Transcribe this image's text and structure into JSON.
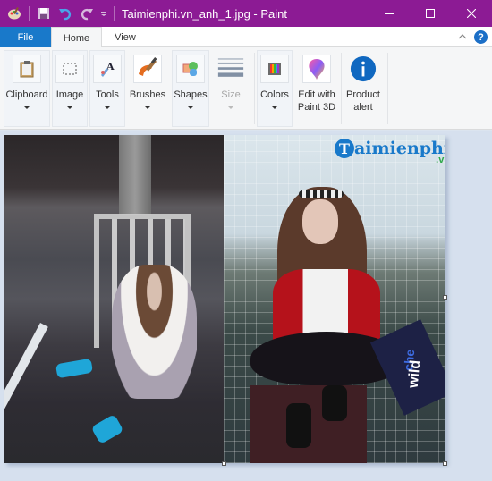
{
  "titlebar": {
    "title": "Taimienphi.vn_anh_1.jpg - Paint",
    "accent_color": "#8c1b94",
    "quick_access": [
      {
        "icon": "paint-app-icon"
      },
      {
        "icon": "save-icon"
      },
      {
        "icon": "undo-icon"
      },
      {
        "icon": "redo-icon"
      },
      {
        "icon": "customize-dropdown-icon"
      }
    ],
    "window_controls": [
      "minimize",
      "maximize",
      "close"
    ]
  },
  "tabs": {
    "items": [
      {
        "label": "File",
        "active": false
      },
      {
        "label": "Home",
        "active": true
      },
      {
        "label": "View",
        "active": false
      }
    ],
    "help_label": "?"
  },
  "ribbon": {
    "groups": [
      {
        "label": "Clipboard",
        "icon": "clipboard-icon",
        "dropdown": true,
        "enabled": true
      },
      {
        "label": "Image",
        "icon": "select-rectangle-icon",
        "dropdown": true,
        "enabled": true
      },
      {
        "label": "Tools",
        "icon": "tools-icon",
        "dropdown": true,
        "enabled": true
      },
      {
        "label": "Brushes",
        "icon": "brush-icon",
        "dropdown": true,
        "enabled": true
      },
      {
        "label": "Shapes",
        "icon": "shapes-icon",
        "dropdown": true,
        "enabled": true
      },
      {
        "label": "Size",
        "icon": "size-lines-icon",
        "dropdown": true,
        "enabled": false
      },
      {
        "label": "Colors",
        "icon": "colors-palette-icon",
        "dropdown": true,
        "enabled": true
      },
      {
        "label": "Edit with Paint 3D",
        "label_line1": "Edit with",
        "label_line2": "Paint 3D",
        "icon": "paint3d-icon",
        "dropdown": false,
        "enabled": true
      },
      {
        "label": "Product alert",
        "label_line1": "Product",
        "label_line2": "alert",
        "icon": "info-icon",
        "dropdown": false,
        "enabled": true
      }
    ]
  },
  "canvas": {
    "image_name": "Taimienphi.vn_anh_1.jpg",
    "watermark": {
      "brand": "aimienphi",
      "brand_initial": "T",
      "suffix": ".vn"
    },
    "sign_text": {
      "line1": "che",
      "line2": "wild"
    }
  }
}
